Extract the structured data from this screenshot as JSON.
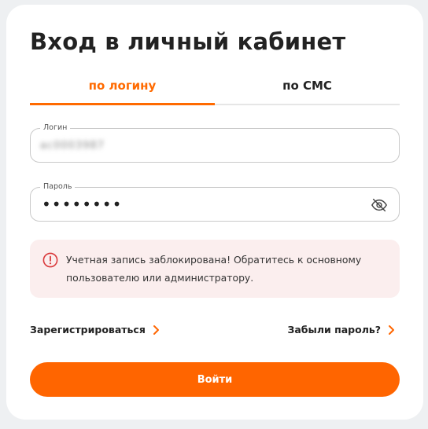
{
  "title": "Вход в личный кабинет",
  "tabs": [
    {
      "label": "по логину",
      "active": true
    },
    {
      "label": "по СМС",
      "active": false
    }
  ],
  "login_field": {
    "label": "Логин",
    "value": "ac0003987"
  },
  "password_field": {
    "label": "Пароль",
    "value": "••••••••"
  },
  "alert": {
    "text": "Учетная запись заблокирована! Обратитесь к основному пользователю или администратору."
  },
  "links": {
    "register": "Зарегистрироваться",
    "forgot": "Забыли пароль?"
  },
  "submit_label": "Войти",
  "colors": {
    "accent": "#ff6500",
    "alert_bg": "#fbeeee",
    "alert_icon": "#d9383a"
  },
  "icons": {
    "password_toggle": "eye-off-icon",
    "alert": "alert-circle-icon",
    "link_arrow": "chevron-right-icon"
  }
}
